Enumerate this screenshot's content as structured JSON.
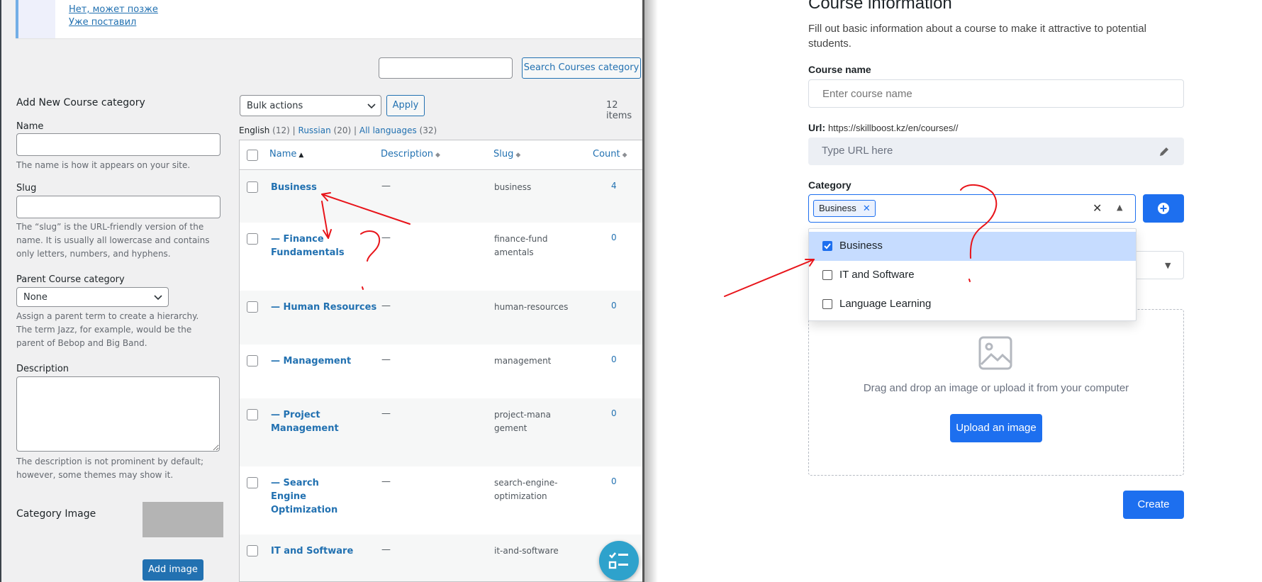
{
  "notice": {
    "link1": "Нет, может позже",
    "link2": "Уже поставил"
  },
  "search": {
    "placeholder": "",
    "button": "Search Courses category"
  },
  "add_form": {
    "heading": "Add New Course category",
    "name_label": "Name",
    "name_help": "The name is how it appears on your site.",
    "slug_label": "Slug",
    "slug_help": "The “slug” is the URL-friendly version of the name. It is usually all lowercase and contains only letters, numbers, and hyphens.",
    "parent_label": "Parent Course category",
    "parent_value": "None",
    "parent_help": "Assign a parent term to create a hierarchy. The term Jazz, for example, would be the parent of Bebop and Big Band.",
    "desc_label": "Description",
    "desc_help": "The description is not prominent by default; however, some themes may show it.",
    "image_label": "Category Image",
    "add_image_button": "Add image"
  },
  "bulk": {
    "select_value": "Bulk actions",
    "apply": "Apply",
    "items_count": "12 items"
  },
  "lang_filter": {
    "english": "English",
    "english_count": "(12)",
    "russian": "Russian",
    "russian_count": "(20)",
    "all": "All languages",
    "all_count": "(32)",
    "sep": "|"
  },
  "table": {
    "headers": {
      "name": "Name",
      "description": "Description",
      "slug": "Slug",
      "count": "Count"
    },
    "rows": [
      {
        "name": "Business",
        "desc": "—",
        "slug": "business",
        "count": "4"
      },
      {
        "name": "— Finance Fundamentals",
        "desc": "—",
        "slug": "finance-fundamentals",
        "count": "0"
      },
      {
        "name": "— Human Resources",
        "desc": "—",
        "slug": "human-resources",
        "count": "0"
      },
      {
        "name": "— Management",
        "desc": "—",
        "slug": "management",
        "count": "0"
      },
      {
        "name": "— Project Management",
        "desc": "—",
        "slug": "project-management",
        "count": "0"
      },
      {
        "name": "— Search Engine Optimization",
        "desc": "—",
        "slug": "search-engine-optimization",
        "count": "0"
      },
      {
        "name": "IT and Software",
        "desc": "—",
        "slug": "it-and-software",
        "count": ""
      }
    ]
  },
  "course_form": {
    "title": "Course information",
    "subtitle": "Fill out basic information about a course to make it attractive to potential students.",
    "name_label": "Course name",
    "name_placeholder": "Enter course name",
    "url_label": "Url:",
    "url_value": "https://skillboost.kz/en/courses//",
    "url_placeholder": "Type URL here",
    "category_label": "Category",
    "selected_tag": "Business",
    "options": [
      {
        "label": "Business",
        "checked": true
      },
      {
        "label": "IT and Software",
        "checked": false
      },
      {
        "label": "Language Learning",
        "checked": false
      }
    ],
    "upload_text": "Drag and drop an image or upload it from your computer",
    "upload_button": "Upload an image",
    "create_button": "Create"
  },
  "colors": {
    "wp_link": "#2271b1",
    "wp_button": "#2271b1",
    "accent_blue": "#1d6fef",
    "selected_option": "#c6dcff",
    "annotation_red": "#e8141a"
  }
}
